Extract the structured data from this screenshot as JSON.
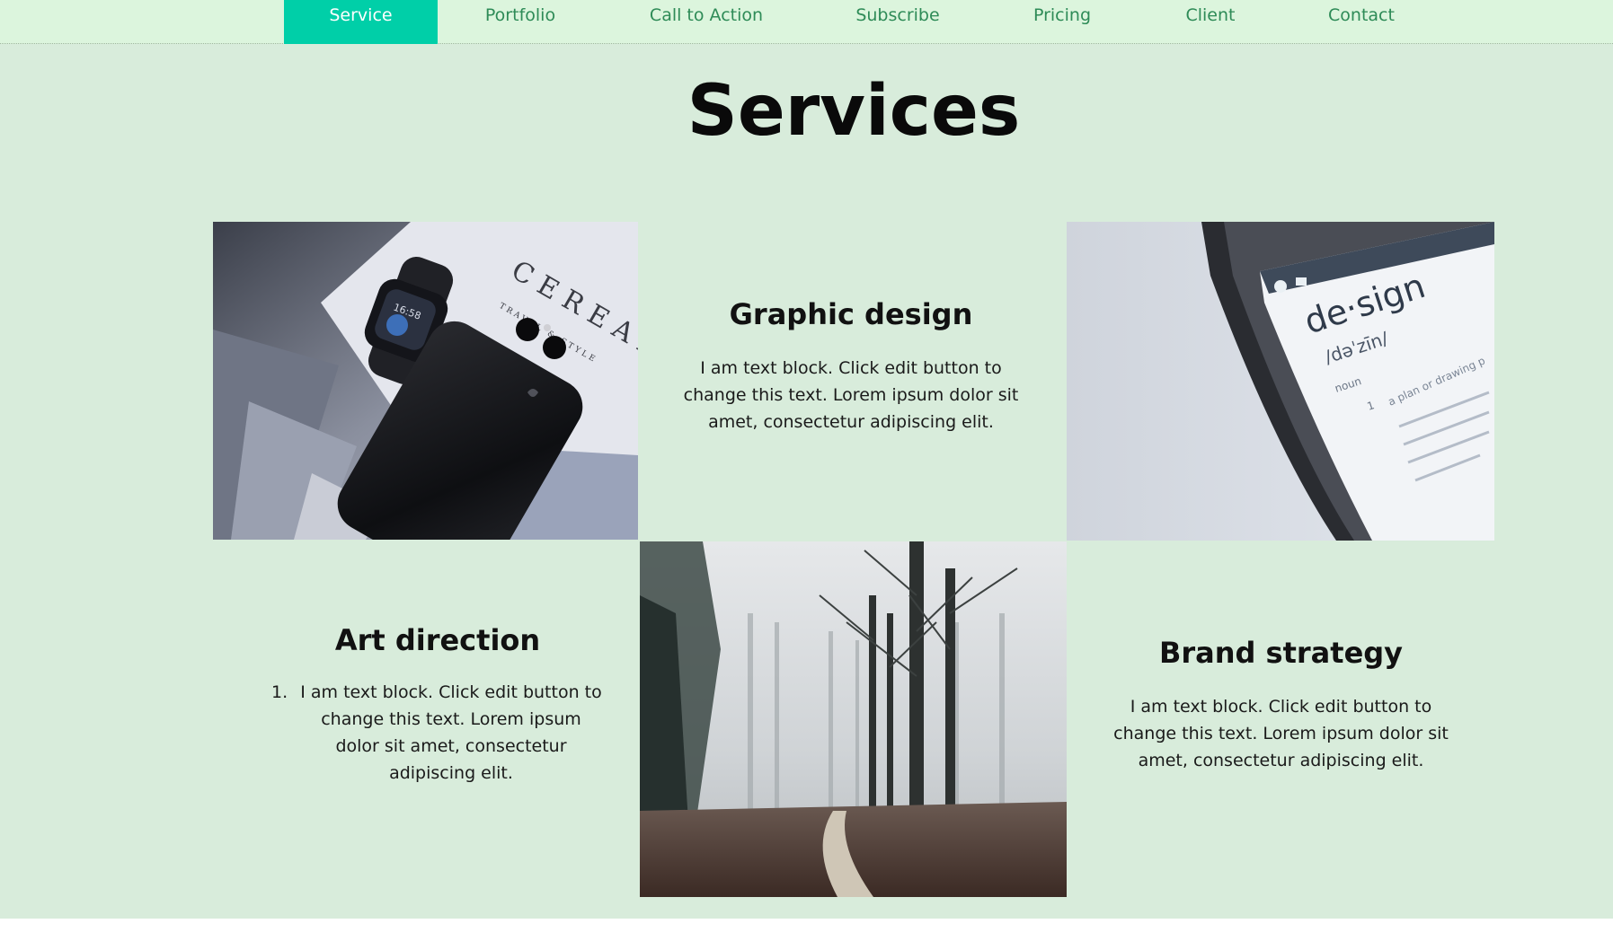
{
  "nav": {
    "items": [
      {
        "label": "Service",
        "active": true
      },
      {
        "label": "Portfolio",
        "active": false
      },
      {
        "label": "Call to Action",
        "active": false
      },
      {
        "label": "Subscribe",
        "active": false
      },
      {
        "label": "Pricing",
        "active": false
      },
      {
        "label": "Client",
        "active": false
      },
      {
        "label": "Contact",
        "active": false
      }
    ]
  },
  "services": {
    "title": "Services",
    "graphic_design": {
      "heading": "Graphic design",
      "text": "I am text block. Click edit button to change this text. Lorem ipsum dolor sit amet, consectetur adipiscing elit."
    },
    "art_direction": {
      "heading": "Art direction",
      "list_number": "1.",
      "text": "I am text block. Click edit button to change this text. Lorem ipsum dolor sit amet, consectetur adipiscing elit."
    },
    "brand_strategy": {
      "heading": "Brand strategy",
      "text": "I am text block. Click edit button to change this text. Lorem ipsum dolor sit amet, consectetur adipiscing elit."
    },
    "images": {
      "devices_photo_text": "CEREAL",
      "devices_photo_subtext": "TRAVEL & STYLE",
      "watch_time": "16:58",
      "phone_word": "de·sign",
      "phone_phonetic": "/dəˈzīn/",
      "phone_pos": "noun",
      "phone_def_num": "1",
      "phone_def": "a plan or drawing p"
    }
  },
  "colors": {
    "nav_bg": "#dcf5dd",
    "nav_active": "#00cfa8",
    "nav_text": "#2e8b57",
    "section_bg": "#d8ecdb"
  }
}
